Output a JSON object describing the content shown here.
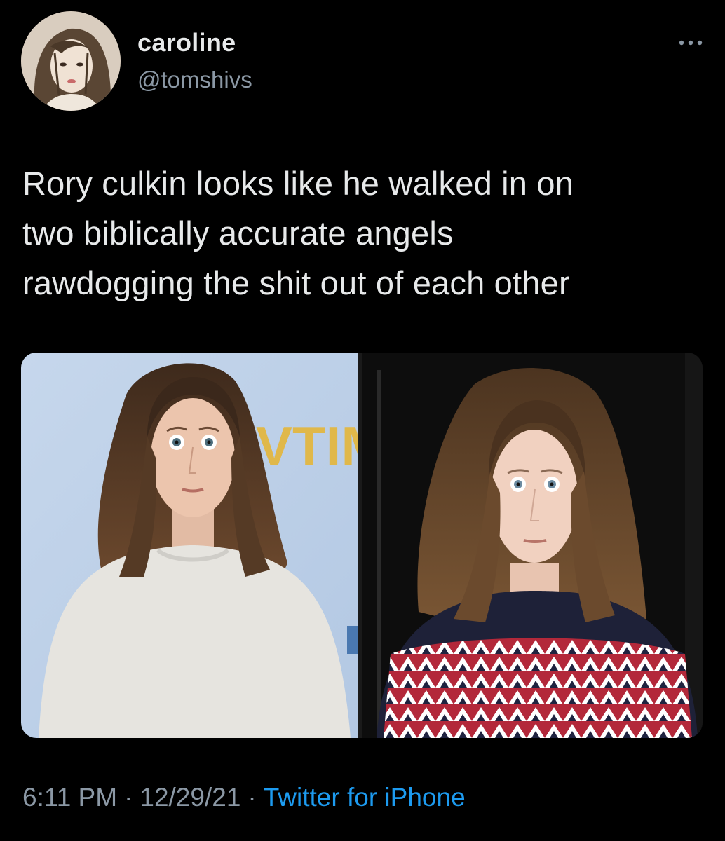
{
  "author": {
    "display_name": "caroline",
    "handle": "@tomshivs",
    "avatar_icon": "user-avatar"
  },
  "tweet": {
    "text": "Rory culkin looks like he walked in on\ntwo biblically accurate angels\nrawdogging the shit out of each other",
    "media": {
      "left_backdrop_text": "VTIM"
    },
    "time": "6:11 PM",
    "date": "12/29/21",
    "separator": "·",
    "source": "Twitter for iPhone"
  },
  "icons": {
    "more": "more-horizontal-icon"
  },
  "colors": {
    "background": "#000000",
    "primary_text": "#e7e9ea",
    "secondary_text": "#8b98a5",
    "link": "#1d9bf0"
  }
}
